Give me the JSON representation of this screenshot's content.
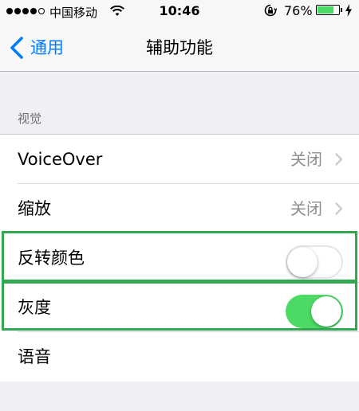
{
  "status_bar": {
    "carrier": "中国移动",
    "time": "10:46",
    "battery_percent": "76%",
    "battery_level": 0.76,
    "signal_bars_filled": 4,
    "signal_bars_total": 5
  },
  "nav": {
    "back_label": "通用",
    "title": "辅助功能"
  },
  "section": {
    "header": "视觉"
  },
  "rows": [
    {
      "label": "VoiceOver",
      "value": "关闭",
      "type": "disclosure"
    },
    {
      "label": "缩放",
      "value": "关闭",
      "type": "disclosure"
    },
    {
      "label": "反转颜色",
      "type": "switch",
      "on": false,
      "highlighted": true
    },
    {
      "label": "灰度",
      "type": "switch",
      "on": true,
      "highlighted": true
    },
    {
      "label": "语音",
      "type": "disclosure"
    }
  ],
  "colors": {
    "accent": "#007aff",
    "switch_on": "#4cd964",
    "highlight": "#33a853",
    "background": "#efeff4"
  }
}
